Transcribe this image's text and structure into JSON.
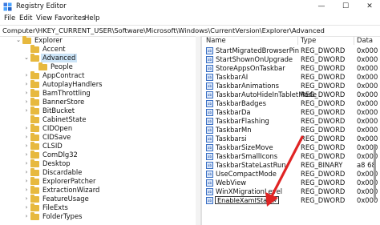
{
  "window": {
    "title": "Registry Editor",
    "minimize": "—",
    "maximize": "☐",
    "close": "✕"
  },
  "menu": [
    "File",
    "Edit",
    "View",
    "Favorites",
    "Help"
  ],
  "address": "Computer\\HKEY_CURRENT_USER\\Software\\Microsoft\\Windows\\CurrentVersion\\Explorer\\Advanced",
  "tree": [
    {
      "label": "Explorer",
      "indent": 28,
      "chev": "v"
    },
    {
      "label": "Accent",
      "indent": 38,
      "chev": ""
    },
    {
      "label": "Advanced",
      "indent": 38,
      "chev": "v",
      "selected": true
    },
    {
      "label": "People",
      "indent": 48,
      "chev": ""
    },
    {
      "label": "AppContract",
      "indent": 38,
      "chev": ">"
    },
    {
      "label": "AutoplayHandlers",
      "indent": 38,
      "chev": ">"
    },
    {
      "label": "BamThrottling",
      "indent": 38,
      "chev": ">"
    },
    {
      "label": "BannerStore",
      "indent": 38,
      "chev": ">"
    },
    {
      "label": "BitBucket",
      "indent": 38,
      "chev": ">"
    },
    {
      "label": "CabinetState",
      "indent": 38,
      "chev": ""
    },
    {
      "label": "CIDOpen",
      "indent": 38,
      "chev": ">"
    },
    {
      "label": "CIDSave",
      "indent": 38,
      "chev": ">"
    },
    {
      "label": "CLSID",
      "indent": 38,
      "chev": ">"
    },
    {
      "label": "ComDlg32",
      "indent": 38,
      "chev": ">"
    },
    {
      "label": "Desktop",
      "indent": 38,
      "chev": ">"
    },
    {
      "label": "Discardable",
      "indent": 38,
      "chev": ">"
    },
    {
      "label": "ExplorerPatcher",
      "indent": 38,
      "chev": ">"
    },
    {
      "label": "ExtractionWizard",
      "indent": 38,
      "chev": ">"
    },
    {
      "label": "FeatureUsage",
      "indent": 38,
      "chev": ">"
    },
    {
      "label": "FileExts",
      "indent": 38,
      "chev": ">"
    },
    {
      "label": "FolderTypes",
      "indent": 38,
      "chev": ">"
    }
  ],
  "columns": {
    "name": "Name",
    "type": "Type",
    "data": "Data"
  },
  "values": [
    {
      "name": "StartMigratedBrowserPin",
      "type": "REG_DWORD",
      "data": "0x000"
    },
    {
      "name": "StartShownOnUpgrade",
      "type": "REG_DWORD",
      "data": "0x000"
    },
    {
      "name": "StoreAppsOnTaskbar",
      "type": "REG_DWORD",
      "data": "0x000"
    },
    {
      "name": "TaskbarAI",
      "type": "REG_DWORD",
      "data": "0x000"
    },
    {
      "name": "TaskbarAnimations",
      "type": "REG_DWORD",
      "data": "0x000"
    },
    {
      "name": "TaskbarAutoHideInTabletMode",
      "type": "REG_DWORD",
      "data": "0x000"
    },
    {
      "name": "TaskbarBadges",
      "type": "REG_DWORD",
      "data": "0x000"
    },
    {
      "name": "TaskbarDa",
      "type": "REG_DWORD",
      "data": "0x000"
    },
    {
      "name": "TaskbarFlashing",
      "type": "REG_DWORD",
      "data": "0x000"
    },
    {
      "name": "TaskbarMn",
      "type": "REG_DWORD",
      "data": "0x000"
    },
    {
      "name": "Taskbarsi",
      "type": "REG_DWORD",
      "data": "0x000"
    },
    {
      "name": "TaskbarSizeMove",
      "type": "REG_DWORD",
      "data": "0x000"
    },
    {
      "name": "TaskbarSmallIcons",
      "type": "REG_DWORD",
      "data": "0x000"
    },
    {
      "name": "TaskbarStateLastRun",
      "type": "REG_BINARY",
      "data": "a8 68"
    },
    {
      "name": "UseCompactMode",
      "type": "REG_DWORD",
      "data": "0x000"
    },
    {
      "name": "WebView",
      "type": "REG_DWORD",
      "data": "0x000"
    },
    {
      "name": "WinXMigrationLevel",
      "type": "REG_DWORD",
      "data": "0x000"
    }
  ],
  "editing_value": {
    "name": "EnableXamlStartMenu",
    "type": "REG_DWORD",
    "data": "0x000"
  },
  "icons": {
    "dword": "reg-dword-icon",
    "folder": "folder-icon",
    "app": "regedit-icon"
  },
  "colors": {
    "selection": "#cce4f7",
    "folder": "#e7b93f",
    "arrow": "#e02424"
  }
}
